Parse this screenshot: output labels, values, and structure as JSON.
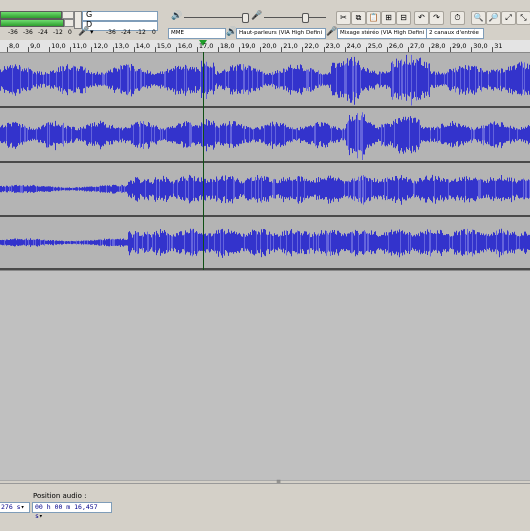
{
  "meters": {
    "upper_ticks": [
      "-24",
      "-12",
      "0"
    ],
    "lower_ticks": [
      "-36",
      "-24",
      "-12",
      "0"
    ],
    "device_ticks": [
      "-36",
      "-24",
      "-12",
      "0"
    ]
  },
  "devices": {
    "host": "MME",
    "playback": "Haut-parleurs (VIA High Defini",
    "recording": "Mixage stéréo (VIA High Defini",
    "channels": "2 canaux d'entrée"
  },
  "ruler": {
    "labels": [
      "8,0",
      "9,0",
      "10,0",
      "11,0",
      "12,0",
      "13,0",
      "14,0",
      "15,0",
      "16,0",
      "17,0",
      "18,0",
      "19,0",
      "20,0",
      "21,0",
      "22,0",
      "23,0",
      "24,0",
      "25,0",
      "26,0",
      "27,0",
      "28,0",
      "29,0",
      "30,0",
      "31"
    ]
  },
  "status": {
    "position_label": "Position audio :",
    "position_value": "00 h 00 m 16,457 s",
    "left_fragment": "276 s"
  },
  "colors": {
    "waveform": "#3333cc",
    "waveform_light": "#6464dc",
    "track_bg": "#b4b4b4",
    "cursor": "#0f4f14"
  }
}
